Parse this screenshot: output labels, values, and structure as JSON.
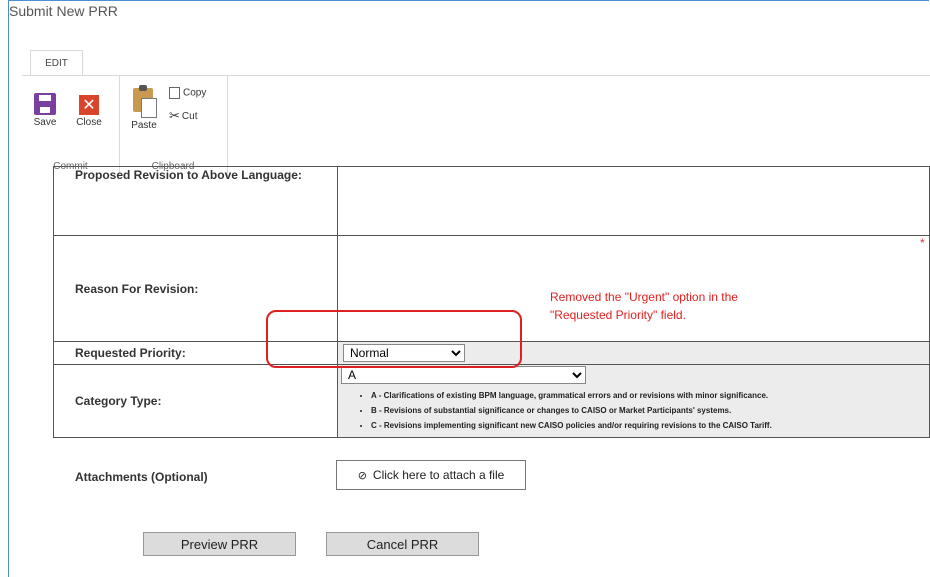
{
  "window": {
    "title": "Submit New PRR"
  },
  "ribbon": {
    "tab": "EDIT",
    "commit": {
      "label": "Commit",
      "save": "Save",
      "close": "Close"
    },
    "clipboard": {
      "label": "Clipboard",
      "paste": "Paste",
      "copy": "Copy",
      "cut": "Cut"
    }
  },
  "form": {
    "proposed_label": "Proposed Revision to Above Language:",
    "reason_label": "Reason For Revision:",
    "required_marker": "*",
    "priority_label": "Requested Priority:",
    "priority_value": "Normal",
    "category_label": "Category Type:",
    "category_value": "A",
    "category_options": [
      "A - Clarifications of existing BPM language, grammatical errors and or revisions with minor significance.",
      "B - Revisions of substantial significance or changes to CAISO or Market Participants' systems.",
      "C - Revisions implementing significant new CAISO policies and/or requiring revisions to the CAISO Tariff."
    ],
    "attach_label": "Attachments (Optional)",
    "attach_button": "Click here to attach a file",
    "preview_button": "Preview PRR",
    "cancel_button": "Cancel PRR"
  },
  "annotation": {
    "line1": "Removed the \"Urgent\" option in the",
    "line2": "\"Requested Priority\" field.",
    "color": "#e02020"
  },
  "colors": {
    "frame_border": "#4a90d9",
    "save_icon": "#7b3fa0",
    "close_icon": "#d9452b",
    "shaded_cell": "#ececec"
  }
}
